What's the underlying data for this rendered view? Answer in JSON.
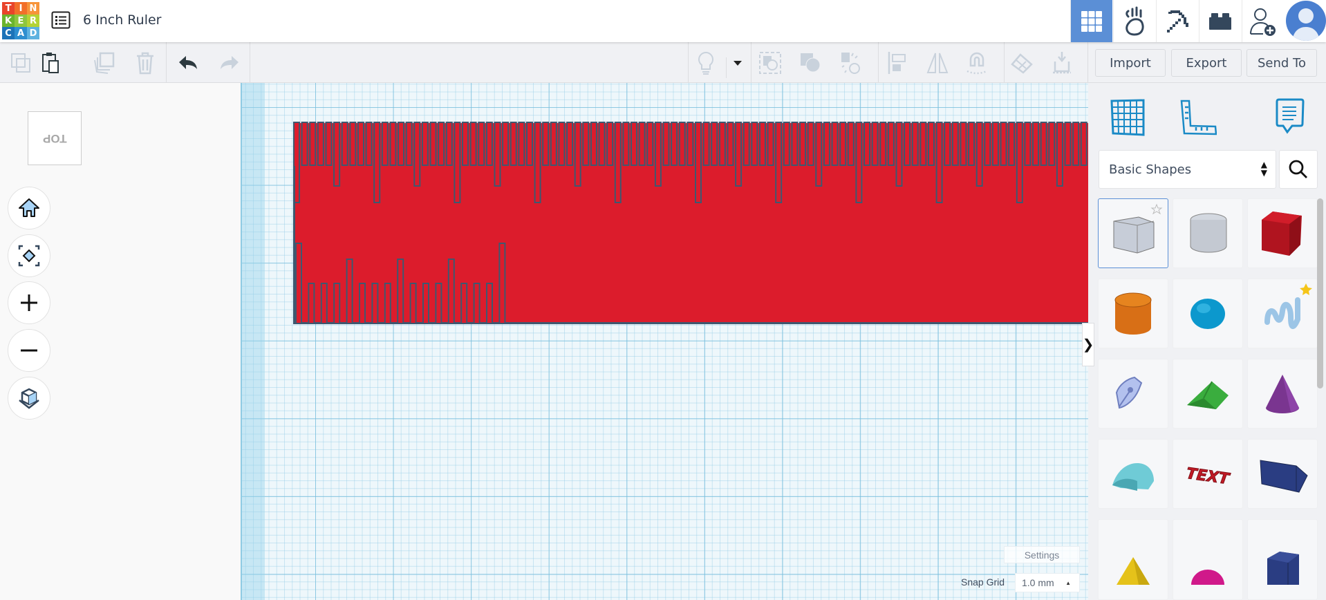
{
  "app": {
    "logo_letters": [
      "T",
      "I",
      "N",
      "K",
      "E",
      "R",
      "C",
      "A",
      "D"
    ],
    "logo_colors": [
      "#e8442b",
      "#f26f29",
      "#f7943a",
      "#6ab42d",
      "#8dc63f",
      "#b4d335",
      "#1d73b8",
      "#2e8fd0",
      "#5eb2e0"
    ]
  },
  "header": {
    "title": "6 Inch Ruler",
    "tiles": [
      {
        "icon": "3d-design-grid-icon",
        "active": true
      },
      {
        "icon": "circuits-hand-icon"
      },
      {
        "icon": "minecraft-pickaxe-icon"
      },
      {
        "icon": "lego-brick-icon"
      },
      {
        "icon": "add-user-icon"
      },
      {
        "icon": "avatar-icon"
      }
    ],
    "accent": "#5b8fd6"
  },
  "toolbar": {
    "icons": [
      "copy-icon",
      "paste-icon",
      "duplicate-icon",
      "delete-icon",
      "undo-icon",
      "redo-icon",
      "notes-lightbulb-icon",
      "dropdown-caret-icon",
      "group-icon",
      "ungroup-icon",
      "hole-solid-icon",
      "align-icon",
      "mirror-icon",
      "magnet-cruise-icon",
      "workplane-icon",
      "drop-icon"
    ],
    "import_label": "Import",
    "export_label": "Export",
    "send_to_label": "Send To"
  },
  "view": {
    "cube_label": "TOP",
    "nav": [
      "home-icon",
      "fit-selection-icon",
      "zoom-in-icon",
      "zoom-out-icon",
      "ortho-perspective-icon"
    ]
  },
  "workplane": {
    "settings_label": "Settings",
    "snap_grid_label": "Snap Grid",
    "snap_grid_value": "1.0 mm"
  },
  "ruler": {
    "color": "#dc1c2c",
    "edge_color": "#3e5870"
  },
  "panel": {
    "tools": [
      "workplane-tool-icon",
      "ruler-tool-icon",
      "notes-tool-icon"
    ],
    "library_select": "Basic Shapes",
    "shapes": [
      "box-hole",
      "cylinder-hole",
      "box",
      "cylinder",
      "sphere",
      "scribble",
      "shape-generator",
      "roof",
      "cone",
      "round-roof",
      "text",
      "wedge",
      "pyramid",
      "half-sphere",
      "polygon"
    ]
  }
}
